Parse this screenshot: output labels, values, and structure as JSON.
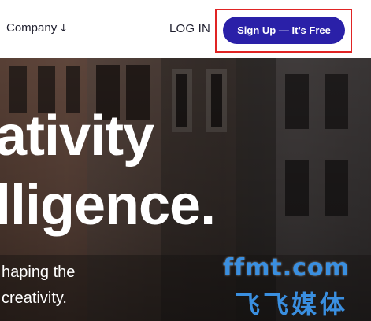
{
  "header": {
    "nav_company_label": "Company",
    "nav_company_arrow": "↓",
    "login_label": "LOG IN",
    "signup_label": "Sign Up — It’s Free"
  },
  "hero": {
    "headline_line1": "ativity",
    "headline_line2": "lligence.",
    "subtext_line1": "haping the",
    "subtext_line2": "creativity."
  },
  "watermark": {
    "top": "ffmt.com",
    "bottom": "飞飞媒体"
  },
  "colors": {
    "signup_button_bg": "#2a20a8",
    "highlight_border": "#e02424",
    "watermark": "#3a8fe0"
  }
}
